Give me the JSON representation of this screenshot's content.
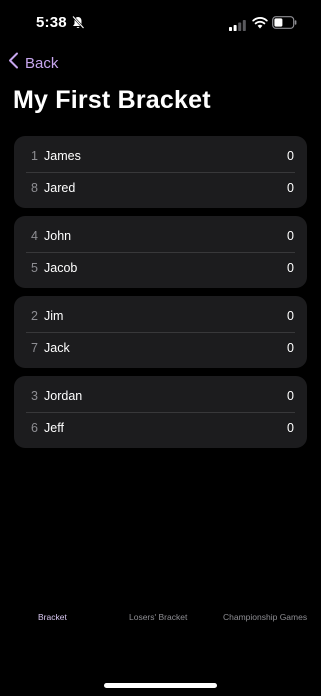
{
  "status_bar": {
    "time": "5:38"
  },
  "nav": {
    "back_label": "Back"
  },
  "page": {
    "title": "My First Bracket"
  },
  "matches": [
    {
      "players": [
        {
          "seed": "1",
          "name": "James",
          "score": "0"
        },
        {
          "seed": "8",
          "name": "Jared",
          "score": "0"
        }
      ]
    },
    {
      "players": [
        {
          "seed": "4",
          "name": "John",
          "score": "0"
        },
        {
          "seed": "5",
          "name": "Jacob",
          "score": "0"
        }
      ]
    },
    {
      "players": [
        {
          "seed": "2",
          "name": "Jim",
          "score": "0"
        },
        {
          "seed": "7",
          "name": "Jack",
          "score": "0"
        }
      ]
    },
    {
      "players": [
        {
          "seed": "3",
          "name": "Jordan",
          "score": "0"
        },
        {
          "seed": "6",
          "name": "Jeff",
          "score": "0"
        }
      ]
    }
  ],
  "tabs": [
    {
      "label": "Bracket",
      "active": true
    },
    {
      "label": "Losers' Bracket",
      "active": false
    },
    {
      "label": "Championship Games",
      "active": false
    }
  ],
  "colors": {
    "accent": "#c7a6ee",
    "background": "#000000",
    "card": "#1c1c1e",
    "secondary_text": "#8e8e93"
  }
}
